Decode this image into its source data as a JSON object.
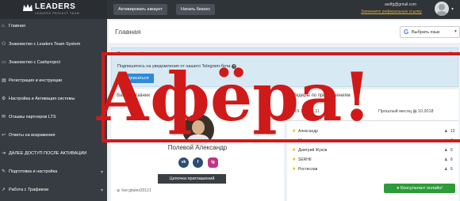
{
  "header": {
    "logo_text": "LEADERS",
    "logo_sub": "LEADERS PROJECT TEAM",
    "btn_activate": "Активировать аккаунт",
    "btn_start": "Начать бизнес",
    "user_email": "asdfg@gmail.com",
    "ref_link": "Запомните реферальную ссылку"
  },
  "sidebar": {
    "items": [
      {
        "label": "Главная",
        "icon": "home-icon"
      },
      {
        "label": "Знакомство с Leaders Team System",
        "icon": "users-icon"
      },
      {
        "label": "Знакомство с Cashproject",
        "icon": "card-icon"
      },
      {
        "label": "Регистрация и инструкции",
        "icon": "doc-icon"
      },
      {
        "label": "Настройка и Активация системы",
        "icon": "gear-icon"
      },
      {
        "label": "Отзывы партнеров LTS",
        "icon": "comment-icon"
      },
      {
        "label": "Ответы на возражения",
        "icon": "reply-icon"
      },
      {
        "label": "ДАЛЕЕ ДОСТУП ПОСЛЕ АКТИВАЦИИ",
        "icon": "lock-icon"
      },
      {
        "label": "Подготовка и настройка",
        "icon": "wrench-icon"
      },
      {
        "label": "Работа с Трафиком",
        "icon": "arrow-icon"
      }
    ]
  },
  "page": {
    "title": "Главная",
    "translate_label": "Выбрать язык"
  },
  "alert": {
    "heading": "Внимание!",
    "text": "Подпишитесь на уведомления от нашего Telegram-бота",
    "button": "Подписаться",
    "close": "×"
  },
  "profile": {
    "heading": "Ваш наставник",
    "name": "Полевой Александр",
    "chain_button": "Цепочка приглашений",
    "link": "live:gitalex20121",
    "social": [
      "vk",
      "f",
      "ig"
    ]
  },
  "leaders": {
    "heading": "Лидеры по приглашениям",
    "tab_current": "19.11 - 25.11",
    "tab_prev_label": "Прошлый месяц",
    "tab_prev_value": "10.2018",
    "rows": [
      {
        "name": "Александр",
        "count": "12"
      },
      {
        "name": "Марина",
        "count": "7"
      },
      {
        "name": "Дмитрий Жуков",
        "count": "6"
      },
      {
        "name": "SERHII",
        "count": "6"
      },
      {
        "name": "Ростислав",
        "count": "6"
      }
    ],
    "consult_button": "Консультант онлайн!"
  },
  "stamp": {
    "text": "Афёра!",
    "color": "#d01a1a"
  }
}
